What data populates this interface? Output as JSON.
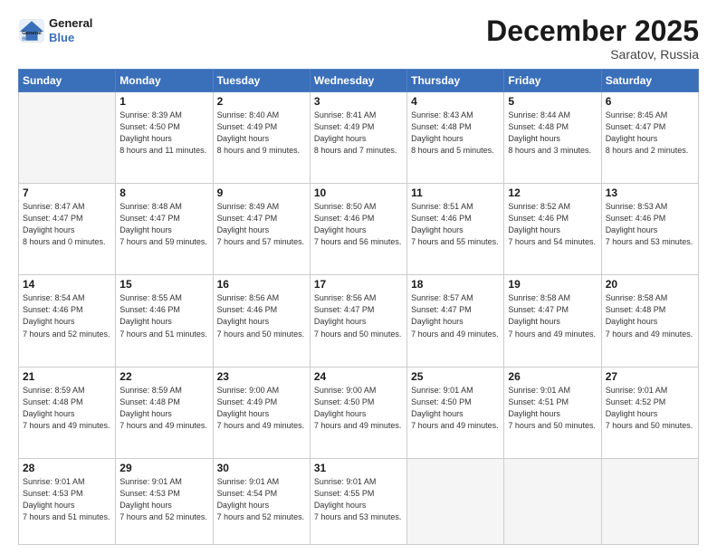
{
  "header": {
    "logo_line1": "General",
    "logo_line2": "Blue",
    "month": "December 2025",
    "location": "Saratov, Russia"
  },
  "weekdays": [
    "Sunday",
    "Monday",
    "Tuesday",
    "Wednesday",
    "Thursday",
    "Friday",
    "Saturday"
  ],
  "weeks": [
    [
      {
        "day": "",
        "empty": true
      },
      {
        "day": "1",
        "sunrise": "8:39 AM",
        "sunset": "4:50 PM",
        "daylight": "8 hours and 11 minutes."
      },
      {
        "day": "2",
        "sunrise": "8:40 AM",
        "sunset": "4:49 PM",
        "daylight": "8 hours and 9 minutes."
      },
      {
        "day": "3",
        "sunrise": "8:41 AM",
        "sunset": "4:49 PM",
        "daylight": "8 hours and 7 minutes."
      },
      {
        "day": "4",
        "sunrise": "8:43 AM",
        "sunset": "4:48 PM",
        "daylight": "8 hours and 5 minutes."
      },
      {
        "day": "5",
        "sunrise": "8:44 AM",
        "sunset": "4:48 PM",
        "daylight": "8 hours and 3 minutes."
      },
      {
        "day": "6",
        "sunrise": "8:45 AM",
        "sunset": "4:47 PM",
        "daylight": "8 hours and 2 minutes."
      }
    ],
    [
      {
        "day": "7",
        "sunrise": "8:47 AM",
        "sunset": "4:47 PM",
        "daylight": "8 hours and 0 minutes."
      },
      {
        "day": "8",
        "sunrise": "8:48 AM",
        "sunset": "4:47 PM",
        "daylight": "7 hours and 59 minutes."
      },
      {
        "day": "9",
        "sunrise": "8:49 AM",
        "sunset": "4:47 PM",
        "daylight": "7 hours and 57 minutes."
      },
      {
        "day": "10",
        "sunrise": "8:50 AM",
        "sunset": "4:46 PM",
        "daylight": "7 hours and 56 minutes."
      },
      {
        "day": "11",
        "sunrise": "8:51 AM",
        "sunset": "4:46 PM",
        "daylight": "7 hours and 55 minutes."
      },
      {
        "day": "12",
        "sunrise": "8:52 AM",
        "sunset": "4:46 PM",
        "daylight": "7 hours and 54 minutes."
      },
      {
        "day": "13",
        "sunrise": "8:53 AM",
        "sunset": "4:46 PM",
        "daylight": "7 hours and 53 minutes."
      }
    ],
    [
      {
        "day": "14",
        "sunrise": "8:54 AM",
        "sunset": "4:46 PM",
        "daylight": "7 hours and 52 minutes."
      },
      {
        "day": "15",
        "sunrise": "8:55 AM",
        "sunset": "4:46 PM",
        "daylight": "7 hours and 51 minutes."
      },
      {
        "day": "16",
        "sunrise": "8:56 AM",
        "sunset": "4:46 PM",
        "daylight": "7 hours and 50 minutes."
      },
      {
        "day": "17",
        "sunrise": "8:56 AM",
        "sunset": "4:47 PM",
        "daylight": "7 hours and 50 minutes."
      },
      {
        "day": "18",
        "sunrise": "8:57 AM",
        "sunset": "4:47 PM",
        "daylight": "7 hours and 49 minutes."
      },
      {
        "day": "19",
        "sunrise": "8:58 AM",
        "sunset": "4:47 PM",
        "daylight": "7 hours and 49 minutes."
      },
      {
        "day": "20",
        "sunrise": "8:58 AM",
        "sunset": "4:48 PM",
        "daylight": "7 hours and 49 minutes."
      }
    ],
    [
      {
        "day": "21",
        "sunrise": "8:59 AM",
        "sunset": "4:48 PM",
        "daylight": "7 hours and 49 minutes."
      },
      {
        "day": "22",
        "sunrise": "8:59 AM",
        "sunset": "4:48 PM",
        "daylight": "7 hours and 49 minutes."
      },
      {
        "day": "23",
        "sunrise": "9:00 AM",
        "sunset": "4:49 PM",
        "daylight": "7 hours and 49 minutes."
      },
      {
        "day": "24",
        "sunrise": "9:00 AM",
        "sunset": "4:50 PM",
        "daylight": "7 hours and 49 minutes."
      },
      {
        "day": "25",
        "sunrise": "9:01 AM",
        "sunset": "4:50 PM",
        "daylight": "7 hours and 49 minutes."
      },
      {
        "day": "26",
        "sunrise": "9:01 AM",
        "sunset": "4:51 PM",
        "daylight": "7 hours and 50 minutes."
      },
      {
        "day": "27",
        "sunrise": "9:01 AM",
        "sunset": "4:52 PM",
        "daylight": "7 hours and 50 minutes."
      }
    ],
    [
      {
        "day": "28",
        "sunrise": "9:01 AM",
        "sunset": "4:53 PM",
        "daylight": "7 hours and 51 minutes."
      },
      {
        "day": "29",
        "sunrise": "9:01 AM",
        "sunset": "4:53 PM",
        "daylight": "7 hours and 52 minutes."
      },
      {
        "day": "30",
        "sunrise": "9:01 AM",
        "sunset": "4:54 PM",
        "daylight": "7 hours and 52 minutes."
      },
      {
        "day": "31",
        "sunrise": "9:01 AM",
        "sunset": "4:55 PM",
        "daylight": "7 hours and 53 minutes."
      },
      {
        "day": "",
        "empty": true
      },
      {
        "day": "",
        "empty": true
      },
      {
        "day": "",
        "empty": true
      }
    ]
  ],
  "labels": {
    "sunrise": "Sunrise:",
    "sunset": "Sunset:",
    "daylight": "Daylight hours"
  }
}
